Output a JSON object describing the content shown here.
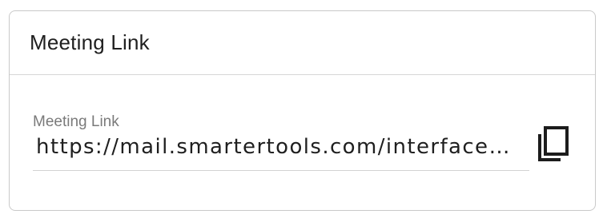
{
  "panel": {
    "title": "Meeting Link"
  },
  "field": {
    "label": "Meeting Link",
    "value": "https://mail.smartertools.com/interface/…"
  },
  "icons": {
    "copy": "copy-icon"
  }
}
